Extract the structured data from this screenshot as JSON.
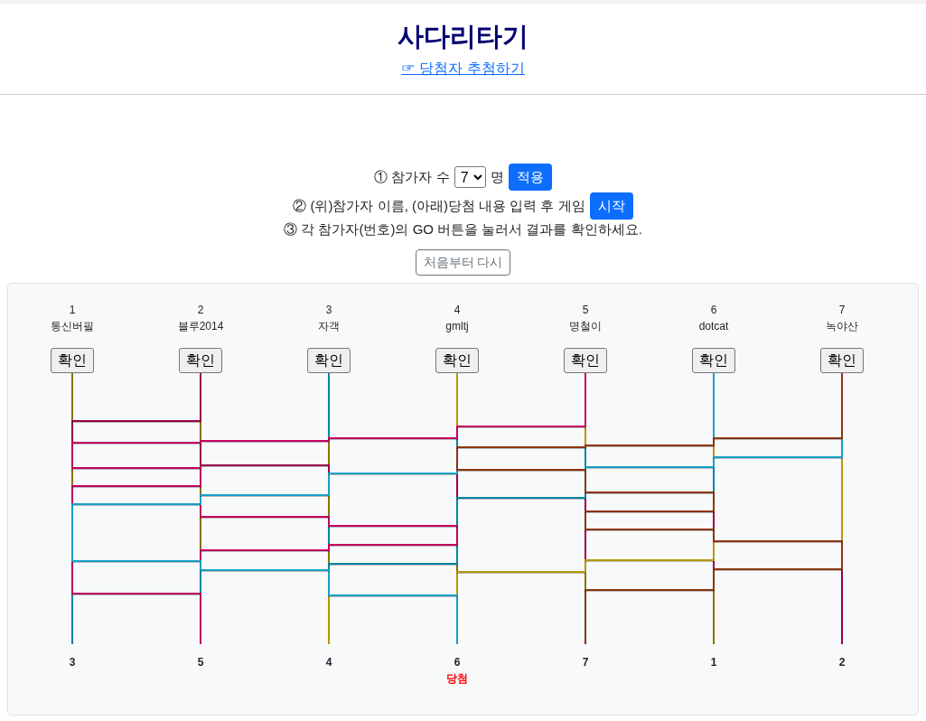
{
  "header": {
    "title": "사다리타기",
    "link": "☞ 당첨자 추첨하기"
  },
  "setup": {
    "step1_label": "① 참가자 수",
    "count": "7",
    "count_unit": "명",
    "apply_button": "적용",
    "step2_label": "② (위)참가자 이름, (아래)당첨 내용 입력 후 게임",
    "start_button": "시작",
    "step3_text": "③ 각 참가자(번호)의 GO 버튼을 눌러서 결과를 확인하세요.",
    "reset_button": "처음부터 다시"
  },
  "ladder": {
    "participants": [
      {
        "number": "1",
        "name": "통신버필",
        "button": "확인",
        "color": "#8a7200"
      },
      {
        "number": "2",
        "name": "블루2014",
        "button": "확인",
        "color": "#9a0048"
      },
      {
        "number": "3",
        "name": "자객",
        "button": "확인",
        "color": "#0086a2"
      },
      {
        "number": "4",
        "name": "gmltj",
        "button": "확인",
        "color": "#b8960c"
      },
      {
        "number": "5",
        "name": "명철이",
        "button": "확인",
        "color": "#c2005f"
      },
      {
        "number": "6",
        "name": "dotcat",
        "button": "확인",
        "color": "#14a0c6"
      },
      {
        "number": "7",
        "name": "녹야산",
        "button": "확인",
        "color": "#883510"
      }
    ],
    "results": [
      {
        "label": "3"
      },
      {
        "label": "5"
      },
      {
        "label": "4"
      },
      {
        "label": "6",
        "prize": "당첨"
      },
      {
        "label": "7"
      },
      {
        "label": "1"
      },
      {
        "label": "2"
      }
    ]
  }
}
